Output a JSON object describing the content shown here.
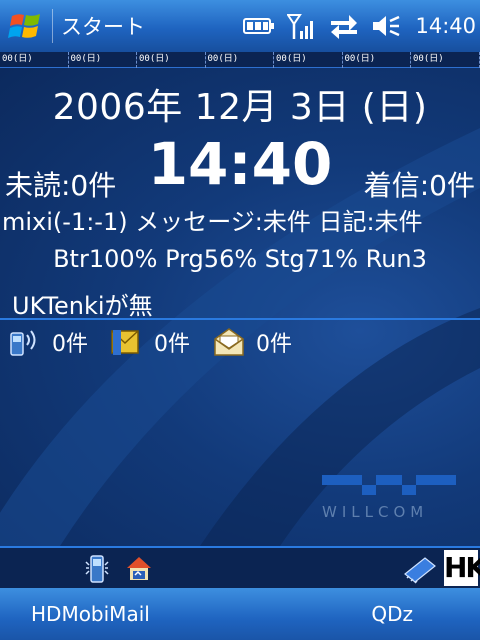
{
  "titlebar": {
    "title": "スタート",
    "time": "14:40"
  },
  "date_strip": {
    "cells": [
      "00(日)",
      "00(日)",
      "00(日)",
      "00(日)",
      "00(日)",
      "00(日)",
      "00(日)"
    ]
  },
  "today": {
    "date": "2006年 12月 3日 (日)",
    "unread": "未読:0件",
    "clock": "14:40",
    "incoming": "着信:0件",
    "mixi": "mixi(-1:-1) メッセージ:未件 日記:未件",
    "battery": "Btr100% Prg56% Stg71% Run3",
    "tenki": "UKTenkiが無",
    "messages": [
      {
        "icon": "phone-signal-icon",
        "count": "0件"
      },
      {
        "icon": "mms-icon",
        "count": "0件"
      },
      {
        "icon": "email-icon",
        "count": "0件"
      }
    ],
    "logo_text": "WILLCOM"
  },
  "tray": {
    "icons": [
      "phone-tray-icon",
      "home-tray-icon",
      "memory-chip-icon",
      "hk-icon"
    ],
    "hk_label": "HK"
  },
  "softkeys": {
    "left": "HDMobiMail",
    "right": "QDz"
  },
  "colors": {
    "title_bar": "#1f64c0",
    "background": "#123a7a",
    "accent": "#2a7ae0"
  }
}
